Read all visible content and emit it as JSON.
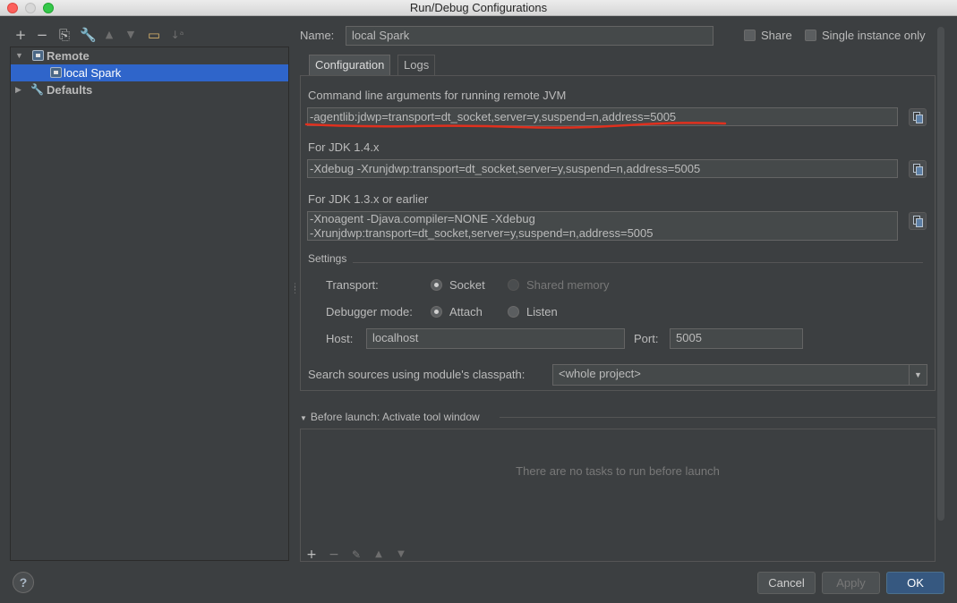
{
  "window": {
    "title": "Run/Debug Configurations"
  },
  "left_toolbar": {
    "buttons": [
      "add",
      "remove",
      "copy",
      "edit-defaults",
      "move-up",
      "move-down",
      "folder",
      "sort"
    ]
  },
  "tree": {
    "items": [
      {
        "label": "Remote",
        "expanded": true,
        "level": 0
      },
      {
        "label": "local Spark",
        "selected": true,
        "level": 1
      },
      {
        "label": "Defaults",
        "expanded": false,
        "level": 0
      }
    ]
  },
  "header": {
    "name_label": "Name:",
    "name_value": "local Spark",
    "share_label": "Share",
    "share_checked": false,
    "single_instance_label": "Single instance only",
    "single_instance_checked": false
  },
  "tabs": [
    {
      "label": "Configuration",
      "active": true
    },
    {
      "label": "Logs",
      "active": false
    }
  ],
  "config": {
    "cmd_args_label": "Command line arguments for running remote JVM",
    "cmd_args_value": "-agentlib:jdwp=transport=dt_socket,server=y,suspend=n,address=5005",
    "jdk14_label": "For JDK 1.4.x",
    "jdk14_value": "-Xdebug -Xrunjdwp:transport=dt_socket,server=y,suspend=n,address=5005",
    "jdk13_label": "For JDK 1.3.x or earlier",
    "jdk13_line1": "-Xnoagent -Djava.compiler=NONE -Xdebug",
    "jdk13_line2": "-Xrunjdwp:transport=dt_socket,server=y,suspend=n,address=5005",
    "settings_label": "Settings",
    "transport_label": "Transport:",
    "transport_options": [
      "Socket",
      "Shared memory"
    ],
    "transport_selected": "Socket",
    "debugger_mode_label": "Debugger mode:",
    "debugger_mode_options": [
      "Attach",
      "Listen"
    ],
    "debugger_mode_selected": "Attach",
    "host_label": "Host:",
    "host_value": "localhost",
    "port_label": "Port:",
    "port_value": "5005",
    "classpath_label": "Search sources using module's classpath:",
    "classpath_value": "<whole project>"
  },
  "before_launch": {
    "title": "Before launch: Activate tool window",
    "empty_text": "There are no tasks to run before launch"
  },
  "footer": {
    "help": "?",
    "cancel": "Cancel",
    "apply": "Apply",
    "ok": "OK"
  },
  "colors": {
    "background": "#3c3f41",
    "selection": "#2f65ca",
    "primary_button": "#365880",
    "annotation": "#e0301e"
  }
}
